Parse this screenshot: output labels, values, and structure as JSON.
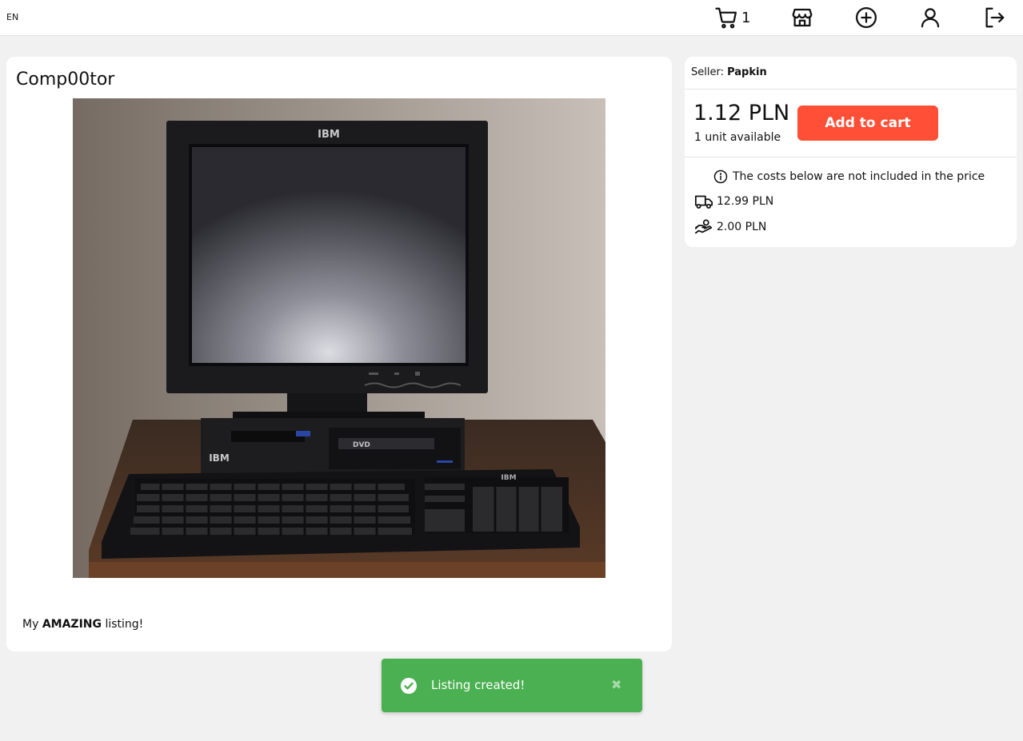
{
  "header": {
    "language": "EN",
    "cart_count": "1",
    "icons": [
      "cart-icon",
      "store-icon",
      "add-circle-icon",
      "user-icon",
      "logout-icon"
    ]
  },
  "listing": {
    "title": "Comp00tor",
    "image_alt": "IBM computer with monitor and keyboard",
    "description_prefix": "My ",
    "description_bold": "AMAZING",
    "description_suffix": " listing!"
  },
  "side": {
    "seller_label": "Seller: ",
    "seller_name": "Papkin",
    "price": "1.12 PLN",
    "availability": "1 unit available",
    "add_to_cart_label": "Add to cart",
    "costs_note": "The costs below are not included in the price",
    "shipping_cost": "12.99 PLN",
    "handling_cost": "2.00 PLN"
  },
  "toast": {
    "message": "Listing created!",
    "close_symbol": "✖"
  },
  "colors": {
    "accent_button": "#ff4f37",
    "toast_background": "#4bb051",
    "page_background": "#f1f1f1"
  }
}
